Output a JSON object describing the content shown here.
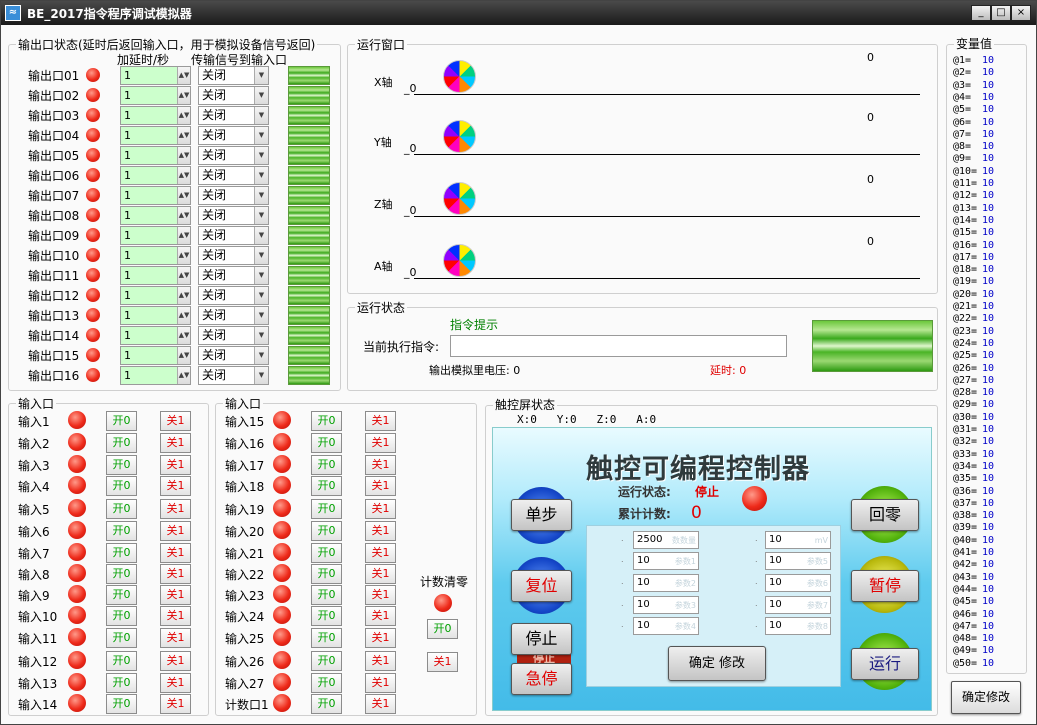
{
  "window": {
    "title": "BE_2017指令程序调试模拟器",
    "minimize": "_",
    "maximize": "□",
    "close": "×",
    "app_icon": "app-icon"
  },
  "output_group": {
    "title": "输出口状态(延时后返回输入口，用于模拟设备信号返回)",
    "col_delay": "加延时/秒",
    "col_transmit": "传输信号到输入口",
    "rows": [
      {
        "label": "输出口01",
        "delay": "1",
        "transmit": "关闭"
      },
      {
        "label": "输出口02",
        "delay": "1",
        "transmit": "关闭"
      },
      {
        "label": "输出口03",
        "delay": "1",
        "transmit": "关闭"
      },
      {
        "label": "输出口04",
        "delay": "1",
        "transmit": "关闭"
      },
      {
        "label": "输出口05",
        "delay": "1",
        "transmit": "关闭"
      },
      {
        "label": "输出口06",
        "delay": "1",
        "transmit": "关闭"
      },
      {
        "label": "输出口07",
        "delay": "1",
        "transmit": "关闭"
      },
      {
        "label": "输出口08",
        "delay": "1",
        "transmit": "关闭"
      },
      {
        "label": "输出口09",
        "delay": "1",
        "transmit": "关闭"
      },
      {
        "label": "输出口10",
        "delay": "1",
        "transmit": "关闭"
      },
      {
        "label": "输出口11",
        "delay": "1",
        "transmit": "关闭"
      },
      {
        "label": "输出口12",
        "delay": "1",
        "transmit": "关闭"
      },
      {
        "label": "输出口13",
        "delay": "1",
        "transmit": "关闭"
      },
      {
        "label": "输出口14",
        "delay": "1",
        "transmit": "关闭"
      },
      {
        "label": "输出口15",
        "delay": "1",
        "transmit": "关闭"
      },
      {
        "label": "输出口16",
        "delay": "1",
        "transmit": "关闭"
      }
    ]
  },
  "run_window": {
    "title": "运行窗口",
    "axes": [
      {
        "label": "X轴",
        "zero": "_0",
        "value": "0"
      },
      {
        "label": "Y轴",
        "zero": "_0",
        "value": "0"
      },
      {
        "label": "Z轴",
        "zero": "_0",
        "value": "0"
      },
      {
        "label": "A轴",
        "zero": "_0",
        "value": "0"
      }
    ]
  },
  "run_status": {
    "title": "运行状态",
    "hint": "指令提示",
    "current_label": "当前执行指令:",
    "current_value": "",
    "voltage": "输出模拟里电压: 0",
    "delay": "延时: 0"
  },
  "inputs_a": {
    "title": "输入口",
    "on_label": "开0",
    "off_label": "关1",
    "items": [
      "输入1",
      "输入2",
      "输入3",
      "输入4",
      "输入5",
      "输入6",
      "输入7",
      "输入8",
      "输入9",
      "输入10",
      "输入11",
      "输入12",
      "输入13",
      "输入14"
    ]
  },
  "inputs_b": {
    "title": "输入口",
    "on_label": "开0",
    "off_label": "关1",
    "items": [
      "输入15",
      "输入16",
      "输入17",
      "输入18",
      "输入19",
      "输入20",
      "输入21",
      "输入22",
      "输入23",
      "输入24",
      "输入25",
      "输入26",
      "输入27",
      "计数口1"
    ]
  },
  "count_reset": {
    "label": "计数清零",
    "on_label": "开0",
    "off_label": "关1"
  },
  "touch": {
    "title": "触控屏状态",
    "coords": "X:0   Y:0   Z:0   A:0",
    "panel_title": "触控可编程控制器",
    "status_label": "运行状态:",
    "status_value": "停止",
    "count_label": "累计计数:",
    "count_value": "0",
    "buttons": {
      "step": "单步",
      "reset": "复位",
      "stop": "停止",
      "estop": "急停",
      "home": "回零",
      "pause": "暂停",
      "run": "运行",
      "confirm": "确定 修改"
    },
    "stop_shadow": "停止",
    "left_fields": [
      {
        "value": "2500",
        "tag": "数数量"
      },
      {
        "value": "10",
        "tag": "参数1"
      },
      {
        "value": "10",
        "tag": "参数2"
      },
      {
        "value": "10",
        "tag": "参数3"
      },
      {
        "value": "10",
        "tag": "参数4"
      }
    ],
    "right_fields": [
      {
        "value": "10",
        "tag": "mV"
      },
      {
        "value": "10",
        "tag": "参数5"
      },
      {
        "value": "10",
        "tag": "参数6"
      },
      {
        "value": "10",
        "tag": "参数7"
      },
      {
        "value": "10",
        "tag": "参数8"
      }
    ]
  },
  "variables": {
    "title": "变量值",
    "confirm_button": "确定修改",
    "items": [
      {
        "name": "@1=",
        "value": "10"
      },
      {
        "name": "@2=",
        "value": "10"
      },
      {
        "name": "@3=",
        "value": "10"
      },
      {
        "name": "@4=",
        "value": "10"
      },
      {
        "name": "@5=",
        "value": "10"
      },
      {
        "name": "@6=",
        "value": "10"
      },
      {
        "name": "@7=",
        "value": "10"
      },
      {
        "name": "@8=",
        "value": "10"
      },
      {
        "name": "@9=",
        "value": "10"
      },
      {
        "name": "@10=",
        "value": "10"
      },
      {
        "name": "@11=",
        "value": "10"
      },
      {
        "name": "@12=",
        "value": "10"
      },
      {
        "name": "@13=",
        "value": "10"
      },
      {
        "name": "@14=",
        "value": "10"
      },
      {
        "name": "@15=",
        "value": "10"
      },
      {
        "name": "@16=",
        "value": "10"
      },
      {
        "name": "@17=",
        "value": "10"
      },
      {
        "name": "@18=",
        "value": "10"
      },
      {
        "name": "@19=",
        "value": "10"
      },
      {
        "name": "@20=",
        "value": "10"
      },
      {
        "name": "@21=",
        "value": "10"
      },
      {
        "name": "@22=",
        "value": "10"
      },
      {
        "name": "@23=",
        "value": "10"
      },
      {
        "name": "@24=",
        "value": "10"
      },
      {
        "name": "@25=",
        "value": "10"
      },
      {
        "name": "@26=",
        "value": "10"
      },
      {
        "name": "@27=",
        "value": "10"
      },
      {
        "name": "@28=",
        "value": "10"
      },
      {
        "name": "@29=",
        "value": "10"
      },
      {
        "name": "@30=",
        "value": "10"
      },
      {
        "name": "@31=",
        "value": "10"
      },
      {
        "name": "@32=",
        "value": "10"
      },
      {
        "name": "@33=",
        "value": "10"
      },
      {
        "name": "@34=",
        "value": "10"
      },
      {
        "name": "@35=",
        "value": "10"
      },
      {
        "name": "@36=",
        "value": "10"
      },
      {
        "name": "@37=",
        "value": "10"
      },
      {
        "name": "@38=",
        "value": "10"
      },
      {
        "name": "@39=",
        "value": "10"
      },
      {
        "name": "@40=",
        "value": "10"
      },
      {
        "name": "@41=",
        "value": "10"
      },
      {
        "name": "@42=",
        "value": "10"
      },
      {
        "name": "@43=",
        "value": "10"
      },
      {
        "name": "@44=",
        "value": "10"
      },
      {
        "name": "@45=",
        "value": "10"
      },
      {
        "name": "@46=",
        "value": "10"
      },
      {
        "name": "@47=",
        "value": "10"
      },
      {
        "name": "@48=",
        "value": "10"
      },
      {
        "name": "@49=",
        "value": "10"
      },
      {
        "name": "@50=",
        "value": "10"
      }
    ]
  },
  "colors": {
    "led_red": "#ee2a1a",
    "on_green": "#00a000",
    "off_red": "#e00000",
    "var_blue": "#0000c8",
    "hint_green": "#008000",
    "status_red": "#e00000"
  }
}
